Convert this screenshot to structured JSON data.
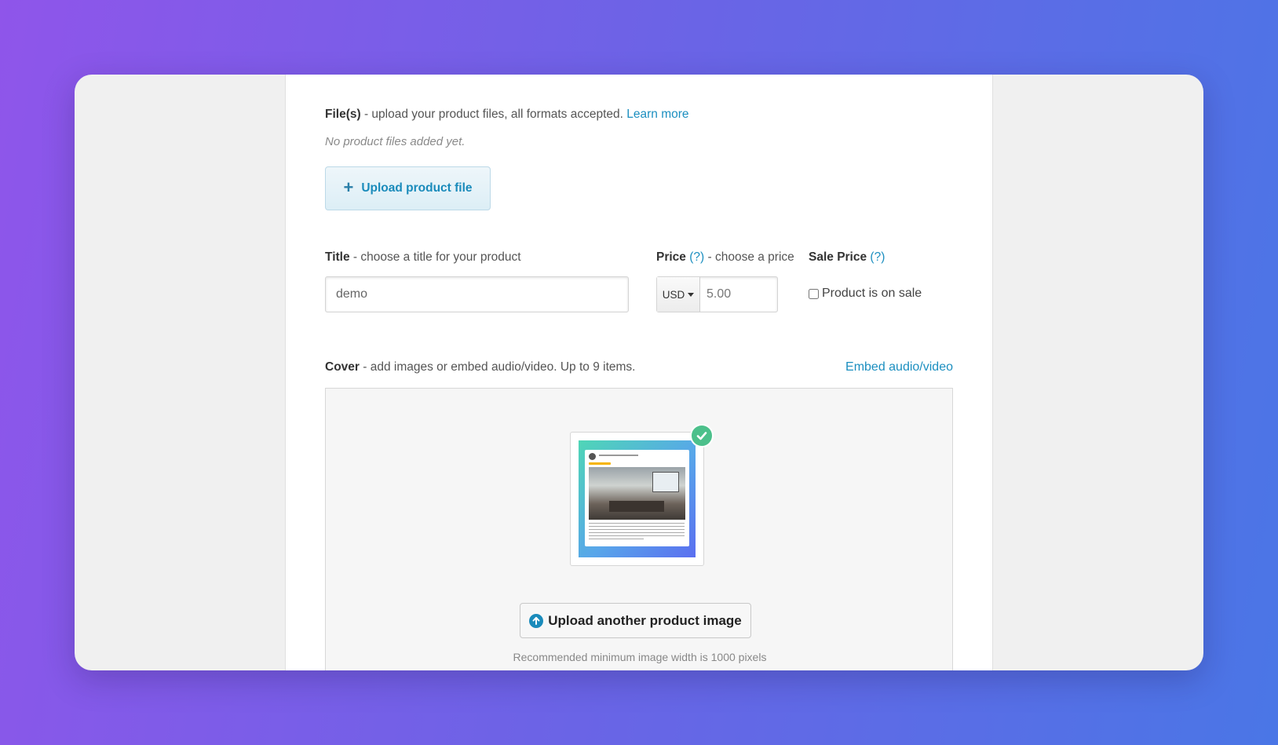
{
  "files": {
    "heading_bold": "File(s)",
    "heading_text": " - upload your product files, all formats accepted. ",
    "learn_more": "Learn more",
    "empty_note": "No product files added yet.",
    "upload_button": "Upload product file"
  },
  "title": {
    "label_bold": "Title",
    "label_text": " - choose a title for your product",
    "value": "demo"
  },
  "price": {
    "label_bold": "Price",
    "help": "(?)",
    "label_text": " - choose a price",
    "currency": "USD",
    "value": "5.00"
  },
  "sale_price": {
    "label_bold": "Sale Price",
    "help": "(?)",
    "checkbox_label": "Product is on sale",
    "checked": false
  },
  "cover": {
    "label_bold": "Cover",
    "label_text": " - add images or embed audio/video. Up to 9 items.",
    "embed_link": "Embed audio/video",
    "upload_button": "Upload another product image",
    "recommendation": "Recommended minimum image width is 1000 pixels"
  },
  "icons": {
    "upload_file": "plus-icon",
    "currency_dropdown": "caret-down-icon",
    "thumbnail_badge": "check-icon",
    "upload_image": "upload-arrow-icon",
    "chat": "chat-bubble-icon"
  },
  "colors": {
    "accent": "#1c8fc0",
    "badge": "#4cc08b",
    "chat": "#1a96c2"
  }
}
